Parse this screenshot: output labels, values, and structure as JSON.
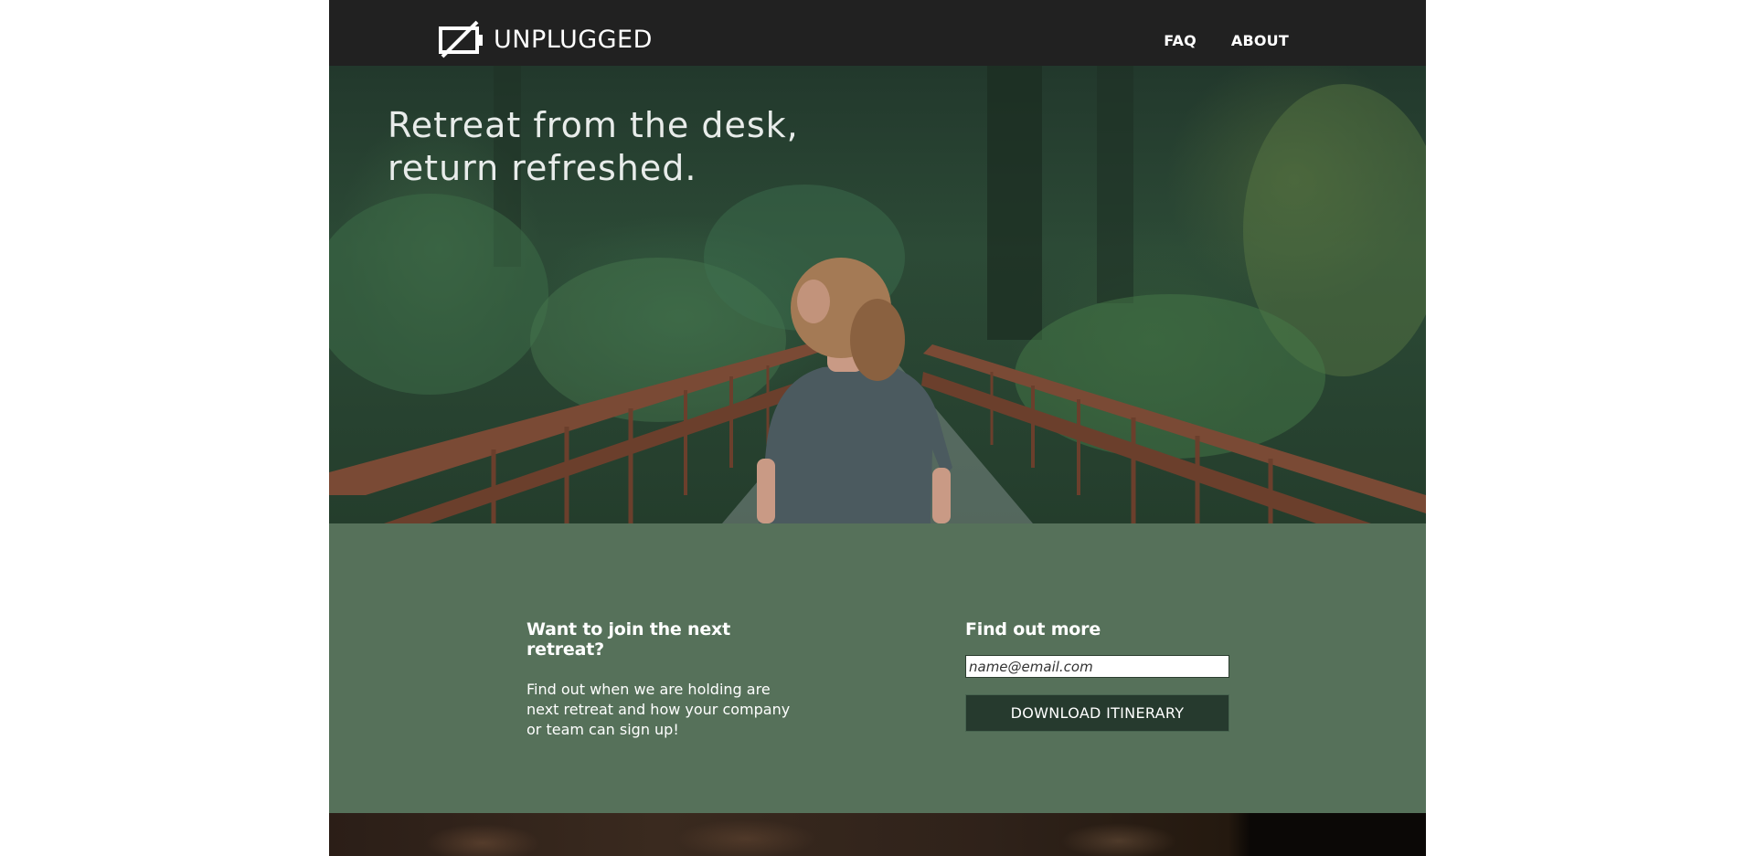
{
  "header": {
    "brand": "UNPLUGGED",
    "nav": [
      {
        "label": "FAQ"
      },
      {
        "label": "ABOUT"
      }
    ]
  },
  "hero": {
    "title": "Retreat from the desk, return refreshed."
  },
  "signup": {
    "title": "Want to join the next retreat?",
    "text": "Find out when we are holding are next retreat and how your company or team can sign up!",
    "find_title": "Find out more",
    "email_placeholder": "name@email.com",
    "download_label": "DOWNLOAD ITINERARY"
  },
  "colors": {
    "header_bg": "#212121",
    "signup_bg": "#56715a",
    "button_bg": "#263a2e"
  }
}
